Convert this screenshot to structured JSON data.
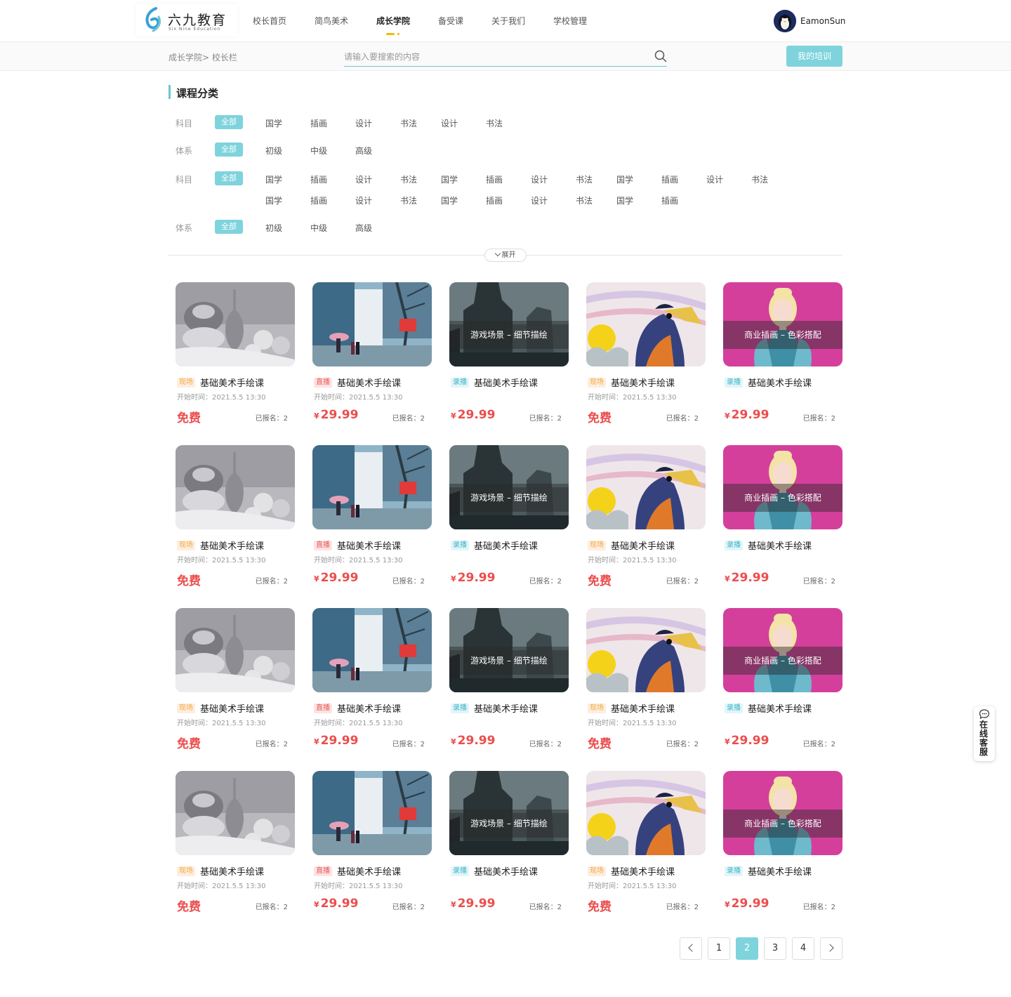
{
  "brand": {
    "name": "六九教育",
    "sub": "Six Nine Education"
  },
  "nav": [
    {
      "label": "校长首页",
      "active": false
    },
    {
      "label": "简鸟美术",
      "active": false
    },
    {
      "label": "成长学院",
      "active": true
    },
    {
      "label": "备受课",
      "active": false
    },
    {
      "label": "关于我们",
      "active": false
    },
    {
      "label": "学校管理",
      "active": false
    }
  ],
  "user": {
    "name": "EamonSun"
  },
  "breadcrumb": "成长学院> 校长栏",
  "search": {
    "placeholder": "请输入要搜索的内容",
    "value": ""
  },
  "my_training": "我的培训",
  "category": {
    "title": "课程分类",
    "label_subject": "科目",
    "label_system": "体系",
    "all_label": "全部",
    "row1": [
      "国学",
      "插画",
      "设计",
      "书法",
      "设计",
      "书法"
    ],
    "row2": [
      "初级",
      "中级",
      "高级"
    ],
    "row3a": [
      "国学",
      "插画",
      "设计",
      "书法",
      "国学",
      "插画",
      "设计",
      "书法",
      "国学",
      "插画",
      "设计",
      "书法"
    ],
    "row3b": [
      "国学",
      "插画",
      "设计",
      "书法",
      "国学",
      "插画",
      "设计",
      "书法",
      "国学",
      "插画"
    ],
    "row4": [
      "初级",
      "中级",
      "高级"
    ],
    "expand": "展开"
  },
  "cards": {
    "title": "基础美术手绘课",
    "time": "开始时间：2021.5.5  13:30",
    "enroll": "已报名：2",
    "free": "免费",
    "yen": "¥",
    "price": "29.99",
    "tag_live": "现场",
    "tag_stream": "直播",
    "tag_rec": "录播",
    "overlay_game": "游戏场景 – 细节描绘",
    "overlay_biz": "商业插画 – 色彩搭配"
  },
  "pagination": {
    "pages": [
      "1",
      "2",
      "3",
      "4"
    ],
    "current": "2"
  },
  "service": "在线客服",
  "colors": {
    "accent": "#7ed3dc",
    "price": "#ec4d4d",
    "nav_indicator": "#f5b800"
  }
}
